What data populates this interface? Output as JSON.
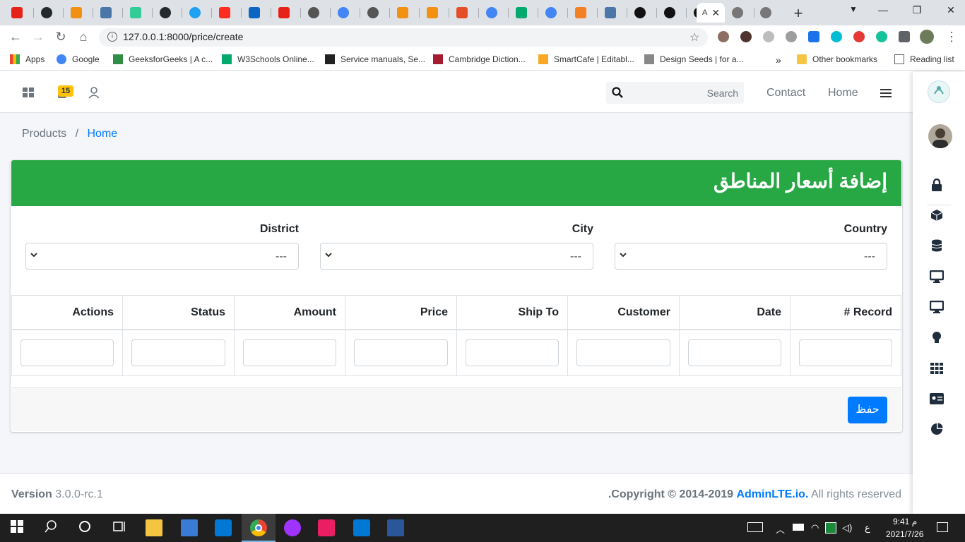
{
  "browser": {
    "tab_count_label": "A",
    "url": "127.0.0.1:8000/price/create",
    "bookmarks": [
      {
        "label": "Apps"
      },
      {
        "label": "Google"
      },
      {
        "label": "GeeksforGeeks | A c..."
      },
      {
        "label": "W3Schools Online..."
      },
      {
        "label": "Service manuals, Se..."
      },
      {
        "label": "Cambridge Diction..."
      },
      {
        "label": "SmartCafe | Editabl..."
      },
      {
        "label": "Design Seeds | for a..."
      },
      {
        "label": "»"
      },
      {
        "label": "Other bookmarks"
      },
      {
        "label": "Reading list"
      }
    ]
  },
  "navbar": {
    "badge_count": "15",
    "search_placeholder": "Search",
    "links": [
      "Contact",
      "Home"
    ]
  },
  "breadcrumb": {
    "items": [
      "Products",
      "/",
      "Home"
    ]
  },
  "card": {
    "title": "إضافة أسعار المناطق",
    "filters": [
      {
        "label": "District",
        "value": "---"
      },
      {
        "label": "City",
        "value": "---"
      },
      {
        "label": "Country",
        "value": "---"
      }
    ],
    "columns": [
      "Actions",
      "Status",
      "Amount",
      "Price",
      "Ship To",
      "Customer",
      "Date",
      "# Record"
    ],
    "save_label": "حفظ"
  },
  "footer": {
    "version_label": "Version",
    "version_value": "3.0.0-rc.1",
    "copyright_prefix": ".Copyright © 2014-2019",
    "copyright_link": "AdminLTE.io.",
    "copyright_suffix": "All rights reserved"
  },
  "taskbar": {
    "time": "9:41 م",
    "date": "2021/7/26",
    "lang": "ع"
  },
  "colors": {
    "header_green": "#28a745",
    "primary_blue": "#007bff",
    "link_blue": "#007bff"
  }
}
